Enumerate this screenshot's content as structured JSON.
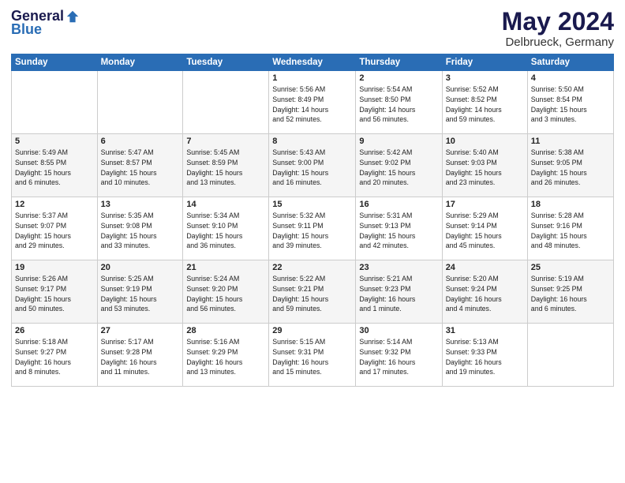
{
  "header": {
    "logo_general": "General",
    "logo_blue": "Blue",
    "month": "May 2024",
    "location": "Delbrueck, Germany"
  },
  "days_of_week": [
    "Sunday",
    "Monday",
    "Tuesday",
    "Wednesday",
    "Thursday",
    "Friday",
    "Saturday"
  ],
  "weeks": [
    [
      {
        "day": "",
        "info": ""
      },
      {
        "day": "",
        "info": ""
      },
      {
        "day": "",
        "info": ""
      },
      {
        "day": "1",
        "info": "Sunrise: 5:56 AM\nSunset: 8:49 PM\nDaylight: 14 hours\nand 52 minutes."
      },
      {
        "day": "2",
        "info": "Sunrise: 5:54 AM\nSunset: 8:50 PM\nDaylight: 14 hours\nand 56 minutes."
      },
      {
        "day": "3",
        "info": "Sunrise: 5:52 AM\nSunset: 8:52 PM\nDaylight: 14 hours\nand 59 minutes."
      },
      {
        "day": "4",
        "info": "Sunrise: 5:50 AM\nSunset: 8:54 PM\nDaylight: 15 hours\nand 3 minutes."
      }
    ],
    [
      {
        "day": "5",
        "info": "Sunrise: 5:49 AM\nSunset: 8:55 PM\nDaylight: 15 hours\nand 6 minutes."
      },
      {
        "day": "6",
        "info": "Sunrise: 5:47 AM\nSunset: 8:57 PM\nDaylight: 15 hours\nand 10 minutes."
      },
      {
        "day": "7",
        "info": "Sunrise: 5:45 AM\nSunset: 8:59 PM\nDaylight: 15 hours\nand 13 minutes."
      },
      {
        "day": "8",
        "info": "Sunrise: 5:43 AM\nSunset: 9:00 PM\nDaylight: 15 hours\nand 16 minutes."
      },
      {
        "day": "9",
        "info": "Sunrise: 5:42 AM\nSunset: 9:02 PM\nDaylight: 15 hours\nand 20 minutes."
      },
      {
        "day": "10",
        "info": "Sunrise: 5:40 AM\nSunset: 9:03 PM\nDaylight: 15 hours\nand 23 minutes."
      },
      {
        "day": "11",
        "info": "Sunrise: 5:38 AM\nSunset: 9:05 PM\nDaylight: 15 hours\nand 26 minutes."
      }
    ],
    [
      {
        "day": "12",
        "info": "Sunrise: 5:37 AM\nSunset: 9:07 PM\nDaylight: 15 hours\nand 29 minutes."
      },
      {
        "day": "13",
        "info": "Sunrise: 5:35 AM\nSunset: 9:08 PM\nDaylight: 15 hours\nand 33 minutes."
      },
      {
        "day": "14",
        "info": "Sunrise: 5:34 AM\nSunset: 9:10 PM\nDaylight: 15 hours\nand 36 minutes."
      },
      {
        "day": "15",
        "info": "Sunrise: 5:32 AM\nSunset: 9:11 PM\nDaylight: 15 hours\nand 39 minutes."
      },
      {
        "day": "16",
        "info": "Sunrise: 5:31 AM\nSunset: 9:13 PM\nDaylight: 15 hours\nand 42 minutes."
      },
      {
        "day": "17",
        "info": "Sunrise: 5:29 AM\nSunset: 9:14 PM\nDaylight: 15 hours\nand 45 minutes."
      },
      {
        "day": "18",
        "info": "Sunrise: 5:28 AM\nSunset: 9:16 PM\nDaylight: 15 hours\nand 48 minutes."
      }
    ],
    [
      {
        "day": "19",
        "info": "Sunrise: 5:26 AM\nSunset: 9:17 PM\nDaylight: 15 hours\nand 50 minutes."
      },
      {
        "day": "20",
        "info": "Sunrise: 5:25 AM\nSunset: 9:19 PM\nDaylight: 15 hours\nand 53 minutes."
      },
      {
        "day": "21",
        "info": "Sunrise: 5:24 AM\nSunset: 9:20 PM\nDaylight: 15 hours\nand 56 minutes."
      },
      {
        "day": "22",
        "info": "Sunrise: 5:22 AM\nSunset: 9:21 PM\nDaylight: 15 hours\nand 59 minutes."
      },
      {
        "day": "23",
        "info": "Sunrise: 5:21 AM\nSunset: 9:23 PM\nDaylight: 16 hours\nand 1 minute."
      },
      {
        "day": "24",
        "info": "Sunrise: 5:20 AM\nSunset: 9:24 PM\nDaylight: 16 hours\nand 4 minutes."
      },
      {
        "day": "25",
        "info": "Sunrise: 5:19 AM\nSunset: 9:25 PM\nDaylight: 16 hours\nand 6 minutes."
      }
    ],
    [
      {
        "day": "26",
        "info": "Sunrise: 5:18 AM\nSunset: 9:27 PM\nDaylight: 16 hours\nand 8 minutes."
      },
      {
        "day": "27",
        "info": "Sunrise: 5:17 AM\nSunset: 9:28 PM\nDaylight: 16 hours\nand 11 minutes."
      },
      {
        "day": "28",
        "info": "Sunrise: 5:16 AM\nSunset: 9:29 PM\nDaylight: 16 hours\nand 13 minutes."
      },
      {
        "day": "29",
        "info": "Sunrise: 5:15 AM\nSunset: 9:31 PM\nDaylight: 16 hours\nand 15 minutes."
      },
      {
        "day": "30",
        "info": "Sunrise: 5:14 AM\nSunset: 9:32 PM\nDaylight: 16 hours\nand 17 minutes."
      },
      {
        "day": "31",
        "info": "Sunrise: 5:13 AM\nSunset: 9:33 PM\nDaylight: 16 hours\nand 19 minutes."
      },
      {
        "day": "",
        "info": ""
      }
    ]
  ]
}
